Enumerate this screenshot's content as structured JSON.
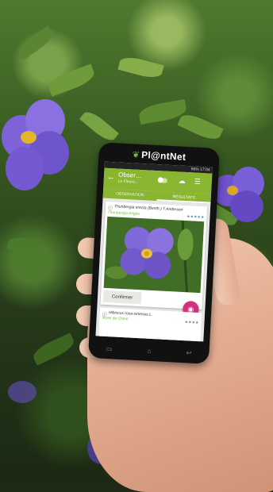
{
  "phone": {
    "brand": "Pl@ntNet"
  },
  "statusbar": {
    "battery": "66%",
    "time": "17:04"
  },
  "appbar": {
    "title": "Obser…",
    "subtitle": "Le Fleuro…",
    "back_icon": "arrow-left-icon",
    "cloud_icon": "cloud-upload-icon",
    "filter_icon": "filter-icon"
  },
  "tabs": [
    {
      "label": "OBSERVATION"
    },
    {
      "label": "RÉSULTATS"
    }
  ],
  "results": [
    {
      "scientific_name": "Thunbergia erecta (Benth.) T.Anderson",
      "common_name": "Thunbergia érigée",
      "stars": "★★★★★"
    },
    {
      "scientific_name": "Hibiscus rosa-sinensis L.",
      "common_name": "Rose de Chine",
      "stars": "★★★★"
    }
  ],
  "confirm_label": "Confirmer",
  "fab_icon": "camera-icon",
  "colors": {
    "app_green": "#8ab531",
    "flower_purple": "#7a5fd6",
    "fab_pink": "#d2317d"
  }
}
